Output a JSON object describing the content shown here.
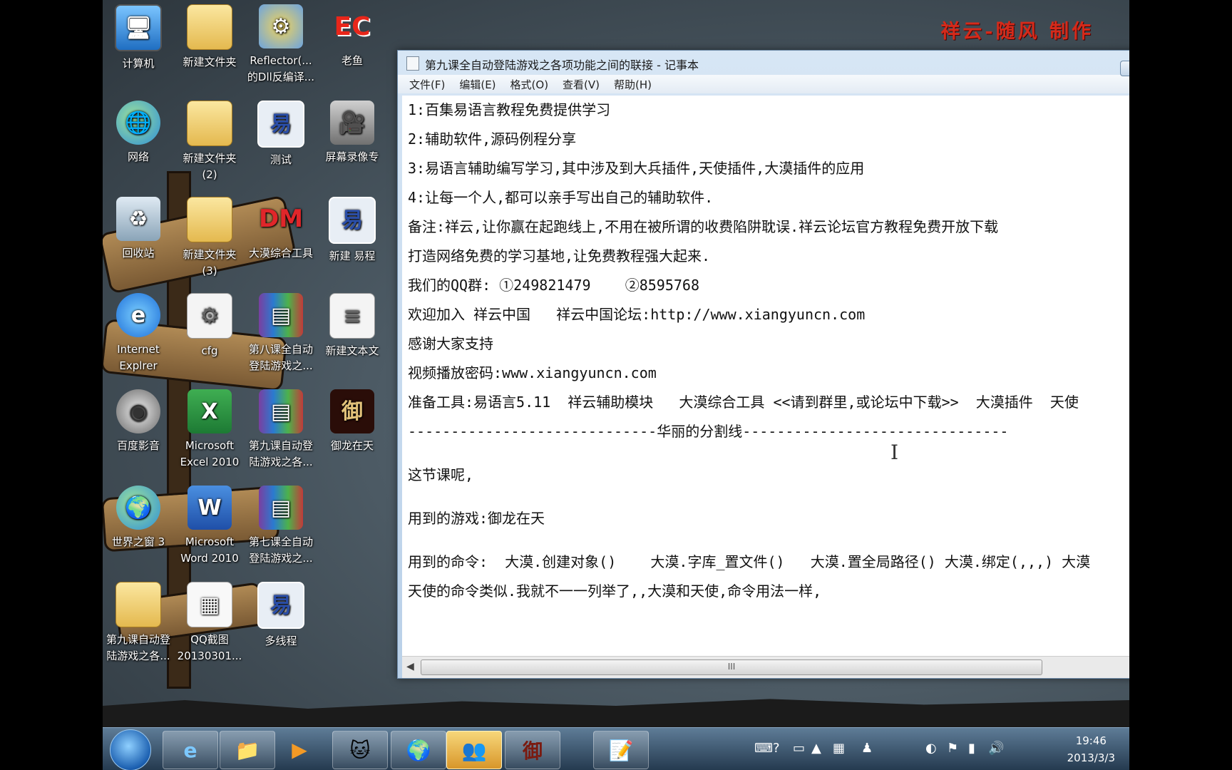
{
  "watermark": "祥云-随风 制作",
  "desktop_icons": [
    {
      "label": "计算机",
      "icon": "computer-icon"
    },
    {
      "label": "新建文件夹",
      "icon": "folder-icon"
    },
    {
      "label": "Reflector(...的Dll反编译...",
      "icon": "reflector-icon"
    },
    {
      "label": "老鱼",
      "icon": "ec-icon"
    },
    {
      "label": "网络",
      "icon": "network-icon"
    },
    {
      "label": "新建文件夹 (2)",
      "icon": "folder-icon"
    },
    {
      "label": "测试",
      "icon": "yi-icon"
    },
    {
      "label": "屏幕录像专",
      "icon": "camera-icon"
    },
    {
      "label": "回收站",
      "icon": "recycle-bin-icon"
    },
    {
      "label": "新建文件夹 (3)",
      "icon": "folder-icon"
    },
    {
      "label": "大漠综合工具",
      "icon": "dm-tool-icon"
    },
    {
      "label": "新建 易程",
      "icon": "yi-icon"
    },
    {
      "label": "Internet Explrer",
      "icon": "ie-icon"
    },
    {
      "label": "cfg",
      "icon": "config-icon"
    },
    {
      "label": "第八课全自动登陆游戏之...",
      "icon": "rar-icon"
    },
    {
      "label": "新建文本文",
      "icon": "text-doc-icon"
    },
    {
      "label": "百度影音",
      "icon": "baidu-video-icon"
    },
    {
      "label": "Microsoft Excel 2010",
      "icon": "excel-icon"
    },
    {
      "label": "第九课自动登陆游戏之各...",
      "icon": "rar-icon"
    },
    {
      "label": "御龙在天",
      "icon": "game-icon"
    },
    {
      "label": "世界之窗 3",
      "icon": "browser-globe-icon"
    },
    {
      "label": "Microsoft Word 2010",
      "icon": "word-icon"
    },
    {
      "label": "第七课全自动登陆游戏之...",
      "icon": "rar-icon"
    },
    {
      "label": "第九课自动登陆游戏之各...",
      "icon": "folder-icon"
    },
    {
      "label": "QQ截图 20130301...",
      "icon": "image-file-icon"
    },
    {
      "label": "多线程",
      "icon": "yi-icon"
    }
  ],
  "icon_glyphs": {
    "computer": "🖥",
    "folder": "📁",
    "reflector": "⚙",
    "ec": "EC",
    "network": "🌐",
    "yi": "易",
    "camera": "🎥",
    "bin": "♻",
    "dm": "DM",
    "ie": "e",
    "cfg": "⚙",
    "rar": "▤",
    "doc": "≡",
    "film": "◉",
    "excel": "X",
    "game": "御",
    "globe": "🌍",
    "word": "W",
    "qq": "▦"
  },
  "notepad": {
    "title": "第九课全自动登陆游戏之各项功能之间的联接 - 记事本",
    "minimize_label": "–",
    "menu": [
      "文件(F)",
      "编辑(E)",
      "格式(O)",
      "查看(V)",
      "帮助(H)"
    ],
    "lines": [
      "1:百集易语言教程免费提供学习",
      "2:辅助软件,源码例程分享",
      "3:易语言辅助编写学习,其中涉及到大兵插件,天使插件,大漠插件的应用",
      "4:让每一个人,都可以亲手写出自己的辅助软件.",
      "备注:祥云,让你赢在起跑线上,不用在被所谓的收费陷阱耽误.祥云论坛官方教程免费开放下载",
      "打造网络免费的学习基地,让免费教程强大起来.",
      "我们的QQ群: ①249821479    ②8595768",
      "欢迎加入 祥云中国   祥云中国论坛:http://www.xiangyuncn.com",
      "感谢大家支持",
      "视频播放密码:www.xiangyuncn.com",
      "准备工具:易语言5.11  祥云辅助模块   大漠综合工具 <<请到群里,或论坛中下载>>  大漠插件  天使",
      "-----------------------------华丽的分割线-------------------------------",
      "这节课呢,",
      "用到的游戏:御龙在天",
      "用到的命令:  大漠.创建对象()    大漠.字库_置文件()   大漠.置全局路径() 大漠.绑定(,,,) 大漠",
      "天使的命令类似.我就不一一列举了,,大漠和天使,命令用法一样,"
    ],
    "scroll_thumb_label": "III",
    "scroll_left_arrow": "◀"
  },
  "taskbar": {
    "clock_time": "19:46",
    "clock_date": "2013/3/3",
    "glyphs": {
      "ie": "e",
      "explorer": "📁",
      "player": "▶",
      "qq_pet": "🐱",
      "globe": "🌍",
      "contacts": "👥",
      "game": "御",
      "notepad": "📝"
    },
    "tray_glyphs": [
      "⌨",
      "?",
      "▭",
      "▲",
      "▦",
      "♟",
      "◐",
      "⚑",
      "▮",
      "🔊"
    ]
  }
}
